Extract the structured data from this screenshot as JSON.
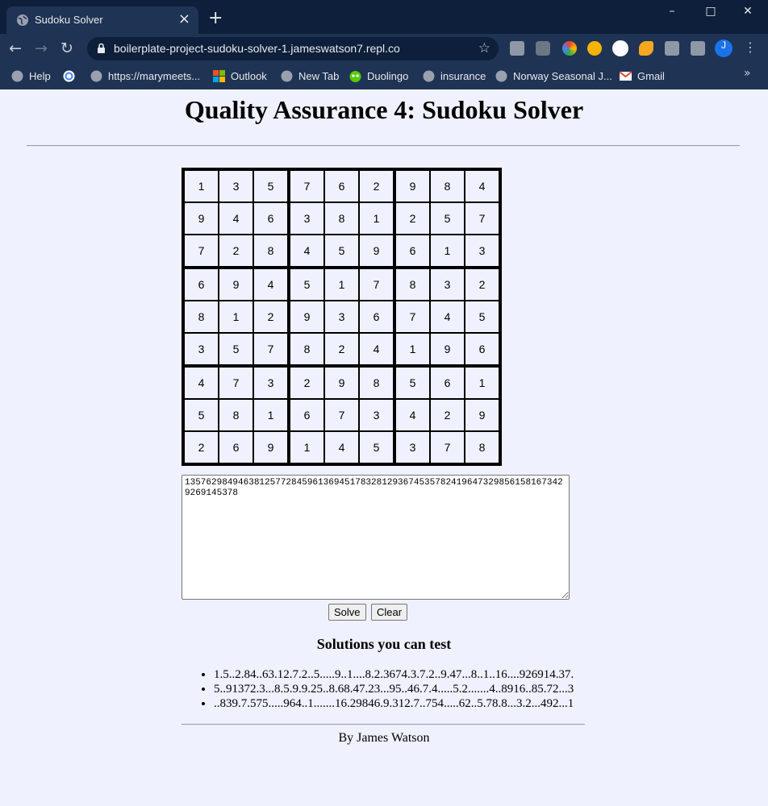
{
  "browser": {
    "tab_title": "Sudoku Solver",
    "url": "boilerplate-project-sudoku-solver-1.jameswatson7.repl.co",
    "profile_initial": "J",
    "bookmarks": [
      "Help",
      "https://marymeets...",
      "Outlook",
      "New Tab",
      "Duolingo",
      "insurance",
      "Norway Seasonal J...",
      "Gmail"
    ]
  },
  "page": {
    "title": "Quality Assurance 4: Sudoku Solver",
    "grid": [
      [
        1,
        3,
        5,
        7,
        6,
        2,
        9,
        8,
        4
      ],
      [
        9,
        4,
        6,
        3,
        8,
        1,
        2,
        5,
        7
      ],
      [
        7,
        2,
        8,
        4,
        5,
        9,
        6,
        1,
        3
      ],
      [
        6,
        9,
        4,
        5,
        1,
        7,
        8,
        3,
        2
      ],
      [
        8,
        1,
        2,
        9,
        3,
        6,
        7,
        4,
        5
      ],
      [
        3,
        5,
        7,
        8,
        2,
        4,
        1,
        9,
        6
      ],
      [
        4,
        7,
        3,
        2,
        9,
        8,
        5,
        6,
        1
      ],
      [
        5,
        8,
        1,
        6,
        7,
        3,
        4,
        2,
        9
      ],
      [
        2,
        6,
        9,
        1,
        4,
        5,
        3,
        7,
        8
      ]
    ],
    "puzzle_text": "135762984946381257728459613694517832812936745357824196473298561581673429269145378",
    "solve_label": "Solve",
    "clear_label": "Clear",
    "solutions_heading": "Solutions you can test",
    "solutions": [
      "1.5..2.84..63.12.7.2..5.....9..1....8.2.3674.3.7.2..9.47...8..1..16....926914.37.",
      "5..91372.3...8.5.9.9.25..8.68.47.23...95..46.7.4.....5.2.......4..8916..85.72...3",
      "..839.7.575.....964..1.......16.29846.9.312.7..754.....62..5.78.8...3.2...492...1"
    ],
    "footer": "By James Watson"
  }
}
